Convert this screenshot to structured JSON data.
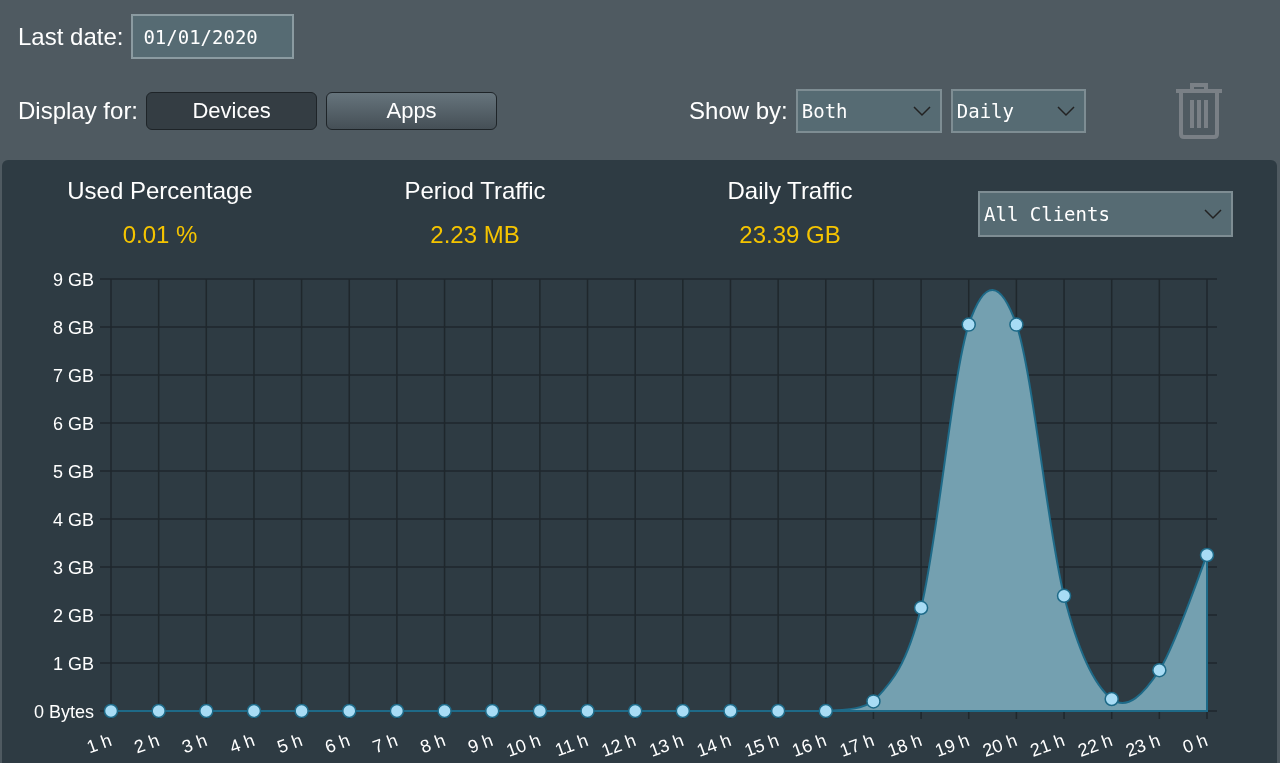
{
  "last_date": {
    "label": "Last date:",
    "value": "01/01/2020"
  },
  "display_for": {
    "label": "Display for:",
    "options": [
      {
        "label": "Devices",
        "selected": true
      },
      {
        "label": "Apps",
        "selected": false
      }
    ]
  },
  "show_by": {
    "label": "Show by:",
    "selects": [
      {
        "value": "Both"
      },
      {
        "value": "Daily"
      }
    ]
  },
  "stats": [
    {
      "label": "Used Percentage",
      "value": "0.01 %"
    },
    {
      "label": "Period Traffic",
      "value": "2.23 MB"
    },
    {
      "label": "Daily Traffic",
      "value": "23.39 GB"
    }
  ],
  "client_select": {
    "value": "All Clients"
  },
  "chart_data": {
    "type": "area",
    "categories": [
      "1 h",
      "2 h",
      "3 h",
      "4 h",
      "5 h",
      "6 h",
      "7 h",
      "8 h",
      "9 h",
      "10 h",
      "11 h",
      "12 h",
      "13 h",
      "14 h",
      "15 h",
      "16 h",
      "17 h",
      "18 h",
      "19 h",
      "20 h",
      "21 h",
      "22 h",
      "23 h",
      "0 h"
    ],
    "grid": true,
    "series": [
      {
        "color": "#74a0b0",
        "values": [
          0,
          0,
          0,
          0,
          0,
          0,
          0,
          0,
          0,
          0,
          0,
          0,
          0,
          0,
          0,
          0,
          0.2,
          2.15,
          8.05,
          8.05,
          2.4,
          0.25,
          0.85,
          3.25
        ]
      }
    ],
    "ylim": [
      0,
      9
    ],
    "yticks": [
      {
        "value": 0,
        "label": "0 Bytes"
      },
      {
        "value": 1,
        "label": "1 GB"
      },
      {
        "value": 2,
        "label": "2 GB"
      },
      {
        "value": 3,
        "label": "3 GB"
      },
      {
        "value": 4,
        "label": "4 GB"
      },
      {
        "value": 5,
        "label": "5 GB"
      },
      {
        "value": 6,
        "label": "6 GB"
      },
      {
        "value": 7,
        "label": "7 GB"
      },
      {
        "value": 8,
        "label": "8 GB"
      },
      {
        "value": 9,
        "label": "9 GB"
      }
    ]
  }
}
